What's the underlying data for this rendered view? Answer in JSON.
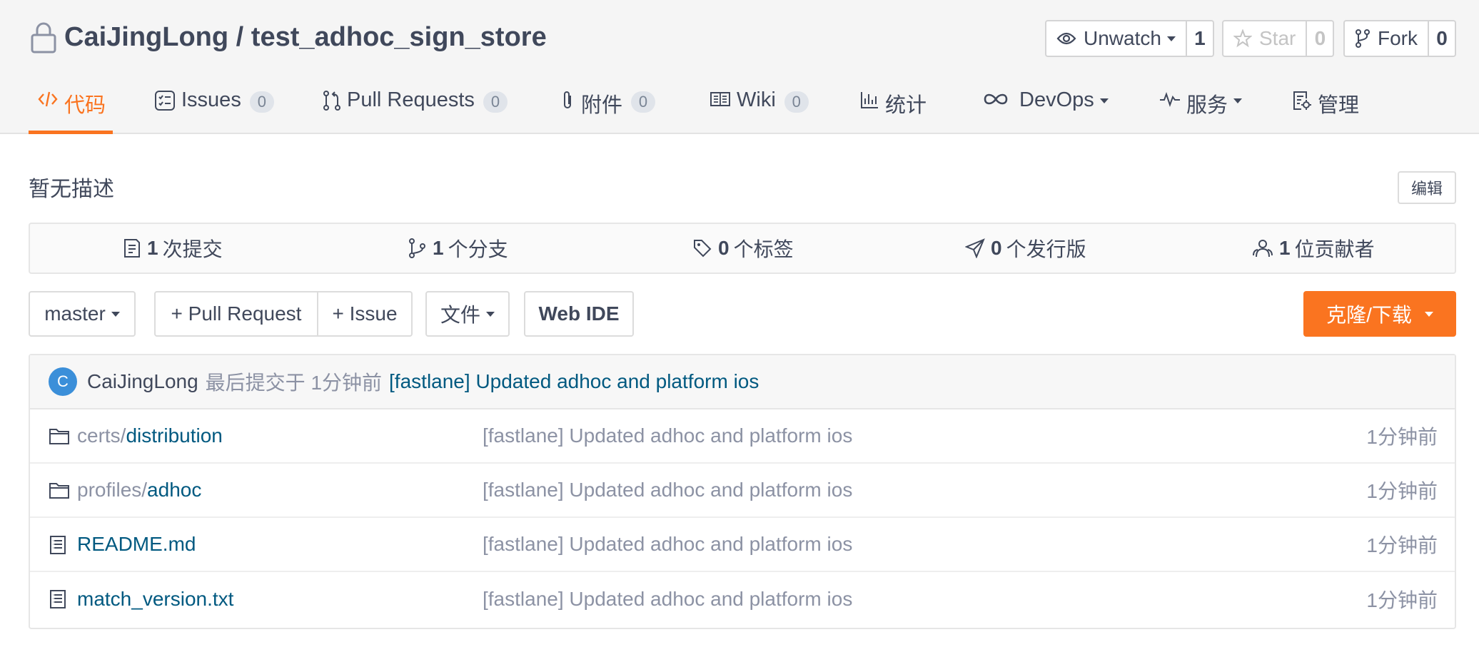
{
  "repo": {
    "owner": "CaiJingLong",
    "separator": " / ",
    "name": "test_adhoc_sign_store"
  },
  "social": {
    "watch": {
      "label": "Unwatch",
      "count": "1"
    },
    "star": {
      "label": "Star",
      "count": "0"
    },
    "fork": {
      "label": "Fork",
      "count": "0"
    }
  },
  "tabs": [
    {
      "label": "代码",
      "badge": ""
    },
    {
      "label": "Issues",
      "badge": "0"
    },
    {
      "label": "Pull Requests",
      "badge": "0"
    },
    {
      "label": "附件",
      "badge": "0"
    },
    {
      "label": "Wiki",
      "badge": "0"
    },
    {
      "label": "统计",
      "badge": ""
    },
    {
      "label": "DevOps",
      "badge": ""
    },
    {
      "label": "服务",
      "badge": ""
    },
    {
      "label": "管理",
      "badge": ""
    }
  ],
  "description": "暂无描述",
  "edit_label": "编辑",
  "stats": [
    {
      "count": "1",
      "label": "次提交"
    },
    {
      "count": "1",
      "label": "个分支"
    },
    {
      "count": "0",
      "label": "个标签"
    },
    {
      "count": "0",
      "label": "个发行版"
    },
    {
      "count": "1",
      "label": "位贡献者"
    }
  ],
  "toolbar": {
    "branch": "master",
    "pull_request": "+ Pull Request",
    "issue": "+ Issue",
    "file": "文件",
    "web_ide": "Web IDE",
    "clone": "克隆/下载"
  },
  "last_commit": {
    "avatar_letter": "C",
    "author": "CaiJingLong",
    "time": "最后提交于 1分钟前",
    "message": "[fastlane] Updated adhoc and platform ios"
  },
  "files": [
    {
      "type": "folder",
      "dir": "certs/",
      "name": "distribution",
      "message": "[fastlane] Updated adhoc and platform ios",
      "time": "1分钟前"
    },
    {
      "type": "folder",
      "dir": "profiles/",
      "name": "adhoc",
      "message": "[fastlane] Updated adhoc and platform ios",
      "time": "1分钟前"
    },
    {
      "type": "file",
      "dir": "",
      "name": "README.md",
      "message": "[fastlane] Updated adhoc and platform ios",
      "time": "1分钟前"
    },
    {
      "type": "file",
      "dir": "",
      "name": "match_version.txt",
      "message": "[fastlane] Updated adhoc and platform ios",
      "time": "1分钟前"
    }
  ],
  "colors": {
    "accent": "#fa7420",
    "link": "#005980",
    "text": "#40485b",
    "muted": "#8c92a4"
  }
}
